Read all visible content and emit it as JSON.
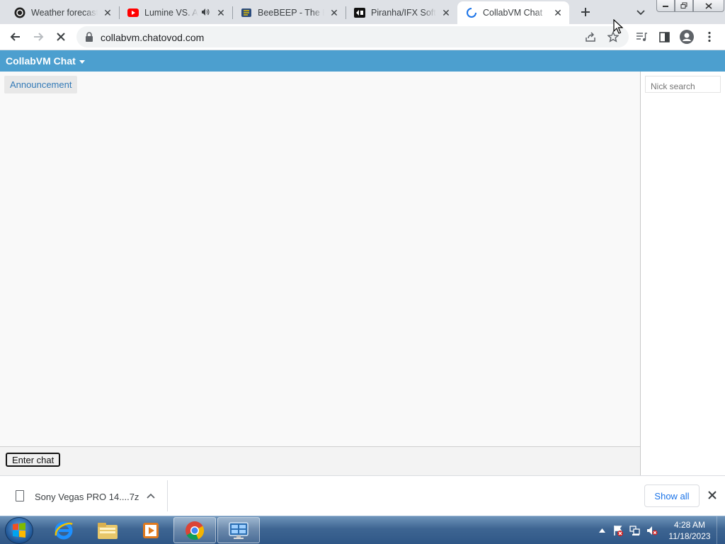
{
  "browser": {
    "tabs": [
      {
        "title": "Weather forecast",
        "icon": "weather-icon",
        "active": false
      },
      {
        "title": "Lumine VS. A",
        "icon": "youtube-icon",
        "active": false,
        "audio": true
      },
      {
        "title": "BeeBEEP - The Po",
        "icon": "beebeep-icon",
        "active": false
      },
      {
        "title": "Piranha/IFX Softw",
        "icon": "piranha-icon",
        "active": false
      },
      {
        "title": "CollabVM Chat",
        "icon": "loading-spinner-icon",
        "active": true
      }
    ],
    "url": "collabvm.chatovod.com"
  },
  "page": {
    "brand": "CollabVM Chat",
    "announcement": "Announcement",
    "nick_search_placeholder": "Nick search",
    "enter_chat": "Enter chat",
    "navbar_color": "#4c9fcf"
  },
  "downloads": {
    "file_name": "Sony Vegas PRO 14....7z",
    "show_all": "Show all"
  },
  "taskbar": {
    "apps": [
      "internet-explorer-icon",
      "file-explorer-icon",
      "media-player-icon",
      "chrome-icon",
      "remote-desktop-icon"
    ],
    "time": "4:28 AM",
    "date": "11/18/2023"
  }
}
